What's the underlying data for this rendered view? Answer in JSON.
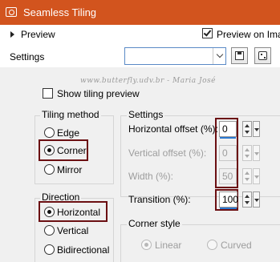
{
  "window": {
    "title": "Seamless Tiling"
  },
  "top": {
    "preview_label": "Preview",
    "preview_on_label": "Preview on Ima",
    "preview_on_checked": true,
    "settings_label": "Settings",
    "settings_value": ""
  },
  "watermark": "www.butterfly.udv.br - Maria José",
  "show_tiling_preview": {
    "label": "Show tiling preview",
    "checked": false
  },
  "tiling_method": {
    "title": "Tiling method",
    "options": [
      "Edge",
      "Corner",
      "Mirror"
    ],
    "selected": "Corner"
  },
  "direction": {
    "title": "Direction",
    "options": [
      "Horizontal",
      "Vertical",
      "Bidirectional"
    ],
    "selected": "Horizontal"
  },
  "settings": {
    "title": "Settings",
    "horizontal_offset": {
      "label": "Horizontal offset (%):",
      "value": "0"
    },
    "vertical_offset": {
      "label": "Vertical offset (%):",
      "value": "0"
    },
    "width": {
      "label": "Width (%):",
      "value": "50"
    },
    "transition": {
      "label": "Transition (%):",
      "value": "100"
    }
  },
  "corner_style": {
    "title": "Corner style",
    "options": [
      "Linear",
      "Curved"
    ],
    "selected": "Linear"
  },
  "colors": {
    "titlebar": "#d2541e",
    "highlight_box": "#6b0f12",
    "panel": "#f0f0f0",
    "accent": "#2b78d0"
  }
}
